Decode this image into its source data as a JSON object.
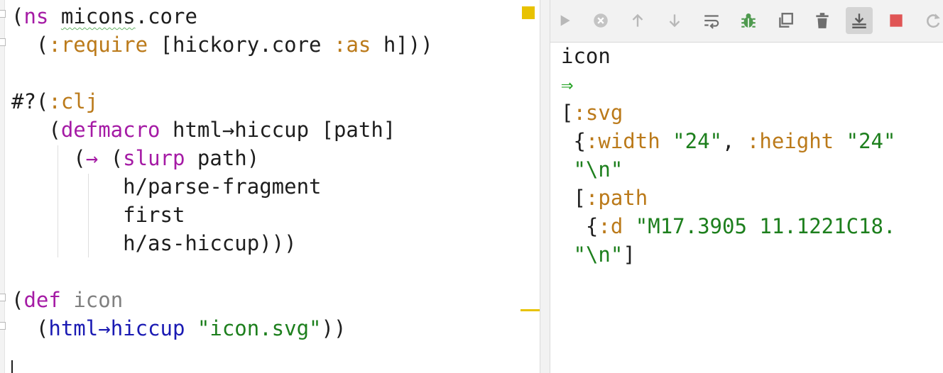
{
  "editor": {
    "lines": [
      [
        {
          "t": "(",
          "c": ""
        },
        {
          "t": "ns",
          "c": "m"
        },
        {
          "t": " ",
          "c": ""
        },
        {
          "t": "micons",
          "c": "squig"
        },
        {
          "t": ".core",
          "c": ""
        }
      ],
      [
        {
          "t": "  (",
          "c": ""
        },
        {
          "t": ":require",
          "c": "k"
        },
        {
          "t": " [hickory.core ",
          "c": ""
        },
        {
          "t": ":as",
          "c": "k"
        },
        {
          "t": " h]))",
          "c": ""
        }
      ],
      [],
      [
        {
          "t": "#?(",
          "c": ""
        },
        {
          "t": ":clj",
          "c": "k"
        }
      ],
      [
        {
          "t": "   (",
          "c": ""
        },
        {
          "t": "defmacro",
          "c": "m"
        },
        {
          "t": " html→hiccup [path]",
          "c": ""
        }
      ],
      [
        {
          "t": "     (",
          "c": ""
        },
        {
          "t": "→",
          "c": "m"
        },
        {
          "t": " (",
          "c": ""
        },
        {
          "t": "slurp",
          "c": "m"
        },
        {
          "t": " path)",
          "c": ""
        }
      ],
      [
        {
          "t": "         h/parse-fragment",
          "c": ""
        }
      ],
      [
        {
          "t": "         first",
          "c": ""
        }
      ],
      [
        {
          "t": "         h/as-hiccup)))",
          "c": ""
        }
      ],
      [],
      [
        {
          "t": "(",
          "c": ""
        },
        {
          "t": "def",
          "c": "m"
        },
        {
          "t": " ",
          "c": ""
        },
        {
          "t": "icon",
          "c": "g"
        }
      ],
      [
        {
          "t": "  (",
          "c": ""
        },
        {
          "t": "html→hiccup",
          "c": "f"
        },
        {
          "t": " ",
          "c": ""
        },
        {
          "t": "\"icon.svg\"",
          "c": "s"
        },
        {
          "t": "))",
          "c": ""
        }
      ]
    ]
  },
  "toolbar": {
    "buttons": [
      {
        "name": "run-icon",
        "color": "#b8b8b8",
        "active": false
      },
      {
        "name": "stop-circle-icon",
        "color": "#c4c4c4",
        "active": false
      },
      {
        "name": "arrow-up-icon",
        "color": "#b8b8b8",
        "active": false
      },
      {
        "name": "arrow-down-icon",
        "color": "#b8b8b8",
        "active": false
      },
      {
        "name": "soft-wrap-icon",
        "color": "#6f6f6f",
        "active": false
      },
      {
        "name": "debug-bug-icon",
        "color": "#4f9a4f",
        "active": false
      },
      {
        "name": "copy-icon",
        "color": "#6f6f6f",
        "active": false
      },
      {
        "name": "trash-icon",
        "color": "#6f6f6f",
        "active": false
      },
      {
        "name": "scroll-to-end-icon",
        "color": "#5a5a5a",
        "active": true
      },
      {
        "name": "stop-square-icon",
        "color": "#e05555",
        "active": false
      },
      {
        "name": "rerun-icon",
        "color": "#b8b8b8",
        "active": false
      }
    ]
  },
  "console": {
    "lines": [
      [
        {
          "t": "icon",
          "c": ""
        }
      ],
      [
        {
          "t": "⇒",
          "c": "arrow"
        }
      ],
      [
        {
          "t": "[",
          "c": ""
        },
        {
          "t": ":svg",
          "c": "k"
        }
      ],
      [
        {
          "t": " {",
          "c": ""
        },
        {
          "t": ":width",
          "c": "k"
        },
        {
          "t": " ",
          "c": ""
        },
        {
          "t": "\"24\"",
          "c": "s"
        },
        {
          "t": ", ",
          "c": ""
        },
        {
          "t": ":height",
          "c": "k"
        },
        {
          "t": " ",
          "c": ""
        },
        {
          "t": "\"24\"",
          "c": "s"
        }
      ],
      [
        {
          "t": " ",
          "c": ""
        },
        {
          "t": "\"\\n\"",
          "c": "s"
        }
      ],
      [
        {
          "t": " [",
          "c": ""
        },
        {
          "t": ":path",
          "c": "k"
        }
      ],
      [
        {
          "t": "  {",
          "c": ""
        },
        {
          "t": ":d",
          "c": "k"
        },
        {
          "t": " ",
          "c": ""
        },
        {
          "t": "\"M17.3905 11.1221C18.",
          "c": "s"
        }
      ],
      [
        {
          "t": " ",
          "c": ""
        },
        {
          "t": "\"\\n\"",
          "c": "s"
        },
        {
          "t": "]",
          "c": ""
        }
      ]
    ]
  },
  "colors": {
    "keyword": "#bb7a1a",
    "string": "#1d7f1d",
    "macro": "#a51ba5",
    "function": "#1a1ab3",
    "warning": "#e8c200"
  }
}
